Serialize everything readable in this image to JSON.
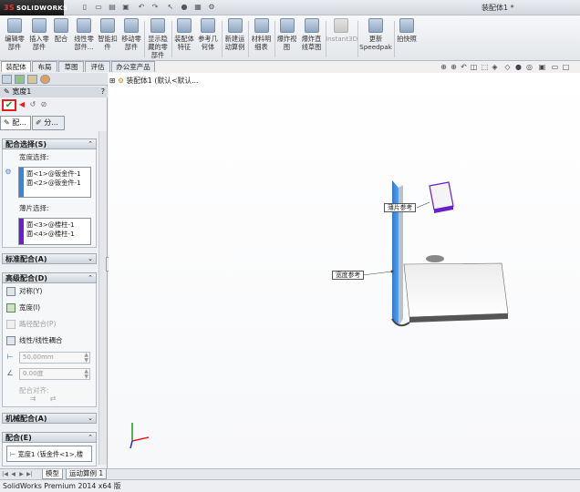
{
  "app": {
    "logo_text": "SOLIDWORKS",
    "doc_title": "装配体1 *",
    "status_text": "SolidWorks Premium 2014 x64 版"
  },
  "ribbon": [
    {
      "label_line1": "编辑零",
      "label_line2": "部件",
      "enabled": true
    },
    {
      "label_line1": "插入零",
      "label_line2": "部件",
      "enabled": true
    },
    {
      "label_line1": "配合",
      "label_line2": "",
      "enabled": true
    },
    {
      "label_line1": "线性零",
      "label_line2": "部件...",
      "enabled": true
    },
    {
      "label_line1": "智能扣",
      "label_line2": "件",
      "enabled": true
    },
    {
      "label_line1": "移动零",
      "label_line2": "部件",
      "enabled": true
    },
    {
      "label_line1": "显示隐",
      "label_line2": "藏的零",
      "label_line3": "部件",
      "enabled": true
    },
    {
      "label_line1": "装配体",
      "label_line2": "特征",
      "enabled": true
    },
    {
      "label_line1": "参考几",
      "label_line2": "何体",
      "enabled": true
    },
    {
      "label_line1": "新建运",
      "label_line2": "动算例",
      "enabled": true
    },
    {
      "label_line1": "材料明",
      "label_line2": "细表",
      "enabled": true
    },
    {
      "label_line1": "爆炸视",
      "label_line2": "图",
      "enabled": true
    },
    {
      "label_line1": "爆炸直",
      "label_line2": "线草图",
      "enabled": true
    },
    {
      "label_line1": "Instant3D",
      "label_line2": "",
      "enabled": false
    },
    {
      "label_line1": "更新",
      "label_line2": "Speedpak",
      "enabled": true
    },
    {
      "label_line1": "拍快照",
      "label_line2": "",
      "enabled": true
    }
  ],
  "command_tabs": [
    "装配体",
    "布局",
    "草图",
    "评估",
    "办公室产品"
  ],
  "property_manager": {
    "title": "宽度1",
    "tabs": [
      "配...",
      "分..."
    ],
    "mate_selections": {
      "header": "配合选择(S)",
      "width_label": "宽度选择:",
      "width_items": [
        "面<1>@钣金件-1",
        "面<2>@钣金件-1"
      ],
      "tab_label": "薄片选择:",
      "tab_items": [
        "面<3>@楼柱-1",
        "面<4>@楼柱-1"
      ]
    },
    "standard_header": "标准配合(A)",
    "advanced": {
      "header": "高级配合(D)",
      "options": [
        "对称(Y)",
        "宽度(I)",
        "路径配合(P)",
        "线性/线性耦合"
      ],
      "distance_value": "50.00mm",
      "angle_value": "0.00度",
      "alignment_label": "配合对齐:"
    },
    "mechanical_header": "机械配合(A)",
    "mates": {
      "header": "配合(E)",
      "item": "宽度1 (钣金件<1>,楼"
    }
  },
  "bottom_tabs": [
    "模型",
    "运动算例 1"
  ],
  "viewport": {
    "tree_root": "装配体1 (默认<默认...",
    "callout_tab": "薄片参考",
    "callout_width": "宽度参考"
  },
  "colors": {
    "accent_blue": "#3a86d6",
    "accent_purple": "#6a1fc8",
    "ok_green": "#1a9a1a",
    "highlight_red": "#e02020"
  }
}
